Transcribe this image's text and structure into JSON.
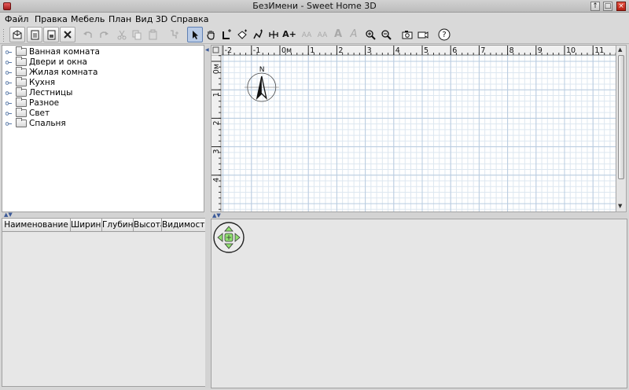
{
  "window": {
    "title": "БезИмени - Sweet Home 3D"
  },
  "menu": [
    "Файл",
    "Правка",
    "Мебель",
    "План",
    "Вид 3D",
    "Справка"
  ],
  "toolbar": {
    "zoom_text_buttons": [
      "AA",
      "AA",
      "A",
      "A"
    ],
    "help_label": "?",
    "add_text_label": "A+"
  },
  "catalog": {
    "categories": [
      "Ванная комната",
      "Двери и окна",
      "Жилая комната",
      "Кухня",
      "Лестницы",
      "Разное",
      "Свет",
      "Спальня"
    ]
  },
  "furniture_table": {
    "columns": [
      "Наименование",
      "Ширина",
      "Глубина",
      "Высота",
      "Видимость"
    ]
  },
  "plan": {
    "x_ruler": [
      "-2",
      "-1",
      "0м",
      "1",
      "2",
      "3",
      "4",
      "5",
      "6",
      "7",
      "8",
      "9",
      "10",
      "11"
    ],
    "y_ruler": [
      "0м",
      "1",
      "2",
      "3",
      "4"
    ],
    "compass_label": "N"
  },
  "colors": {
    "grid_fine": "#dde7f0",
    "grid_major": "#b9cce0",
    "navigator_green": "#90e070"
  }
}
